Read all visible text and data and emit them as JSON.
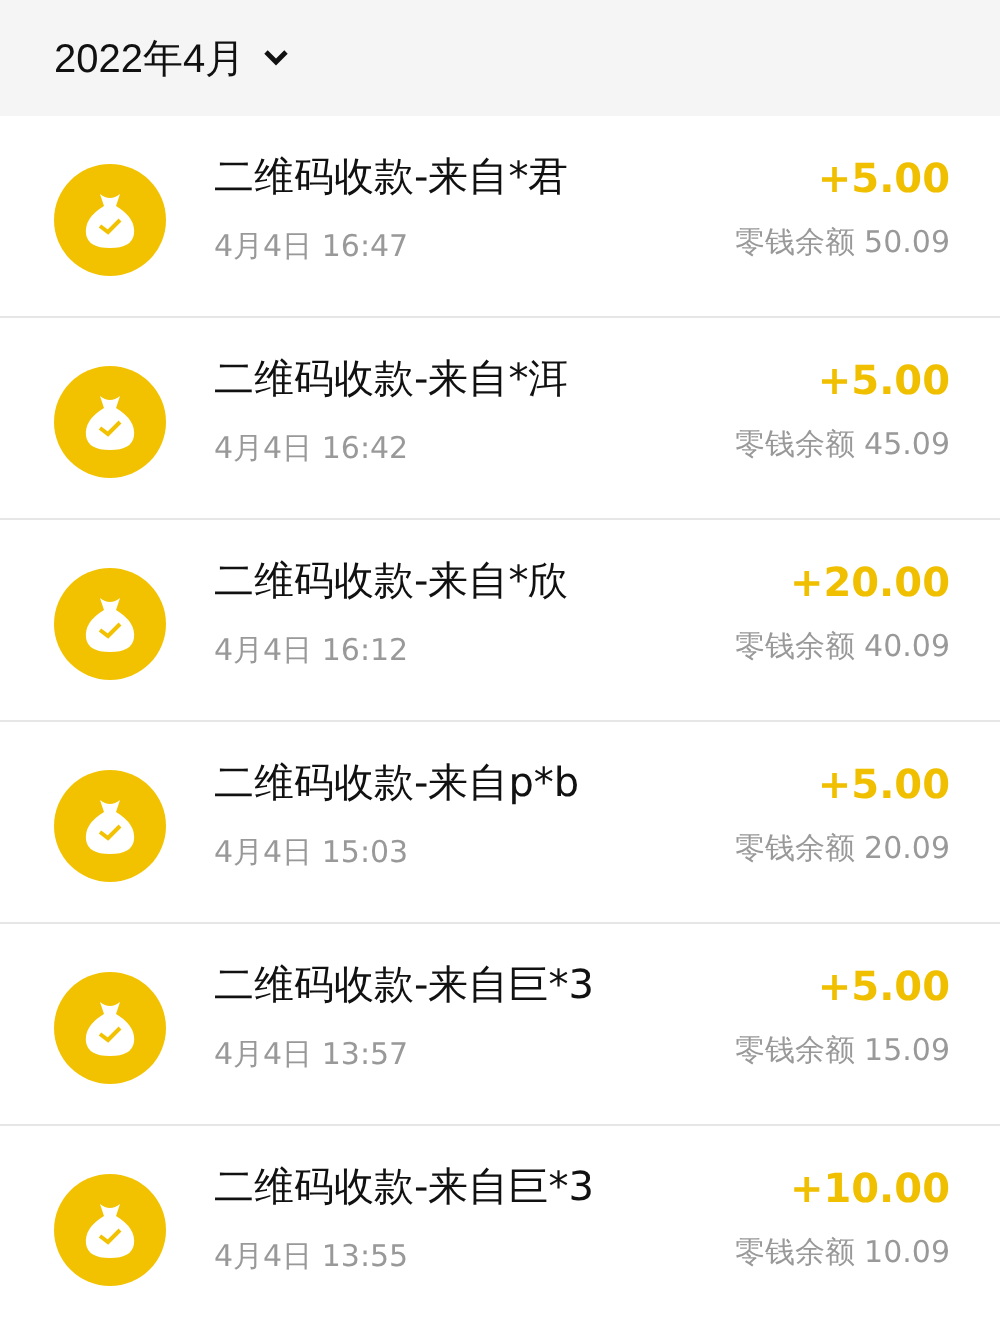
{
  "header": {
    "month": "2022年4月"
  },
  "transactions": [
    {
      "title": "二维码收款-来自*君",
      "time": "4月4日 16:47",
      "amount": "+5.00",
      "balance": "零钱余额 50.09"
    },
    {
      "title": "二维码收款-来自*洱",
      "time": "4月4日 16:42",
      "amount": "+5.00",
      "balance": "零钱余额 45.09"
    },
    {
      "title": "二维码收款-来自*欣",
      "time": "4月4日 16:12",
      "amount": "+20.00",
      "balance": "零钱余额 40.09"
    },
    {
      "title": "二维码收款-来自p*b",
      "time": "4月4日 15:03",
      "amount": "+5.00",
      "balance": "零钱余额 20.09"
    },
    {
      "title": "二维码收款-来自巨*3",
      "time": "4月4日 13:57",
      "amount": "+5.00",
      "balance": "零钱余额 15.09"
    },
    {
      "title": "二维码收款-来自巨*3",
      "time": "4月4日 13:55",
      "amount": "+10.00",
      "balance": "零钱余额 10.09"
    }
  ]
}
